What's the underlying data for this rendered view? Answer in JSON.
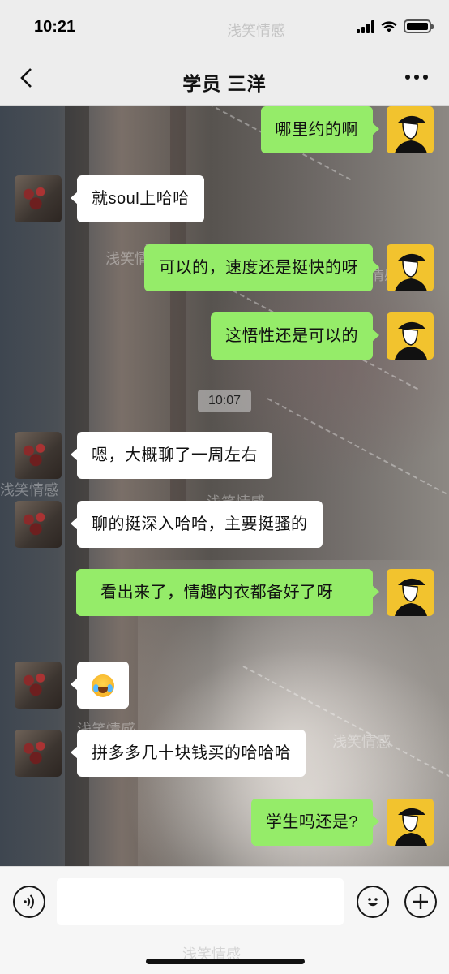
{
  "status_bar": {
    "time": "10:21"
  },
  "header": {
    "title": "学员  三洋"
  },
  "watermark": "浅笑情感",
  "messages": [
    {
      "side": "me",
      "text": "哪里约的啊"
    },
    {
      "side": "other",
      "text": "就soul上哈哈"
    },
    {
      "side": "me",
      "text": "可以的，速度还是挺快的呀"
    },
    {
      "side": "me",
      "text": "这悟性还是可以的"
    },
    {
      "side": "other",
      "text": "嗯，大概聊了一周左右"
    },
    {
      "side": "other",
      "text": "聊的挺深入哈哈，主要挺骚的"
    },
    {
      "side": "me",
      "text": "  看出来了，情趣内衣都备好了呀"
    },
    {
      "side": "other",
      "emoji": "crying-laughing-emoji"
    },
    {
      "side": "other",
      "text": "拼多多几十块钱买的哈哈哈"
    },
    {
      "side": "me",
      "text": "学生吗还是?"
    }
  ],
  "timestamp_chip": "10:07",
  "input": {
    "value": ""
  },
  "colors": {
    "sent_bubble": "#95ec69",
    "received_bubble": "#ffffff",
    "avatar_me_bg": "#f2c32e"
  }
}
